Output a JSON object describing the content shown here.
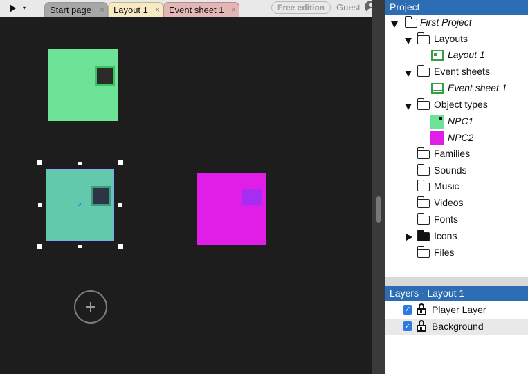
{
  "toolbar": {
    "tabs": [
      {
        "label": "Start page",
        "close": "×"
      },
      {
        "label": "Layout 1",
        "close": "×"
      },
      {
        "label": "Event sheet 1",
        "close": "×"
      }
    ],
    "edition_label": "Free edition",
    "user_label": "Guest",
    "play_dropdown": "▾"
  },
  "canvas": {
    "objects": [
      "NPC1",
      "NPC1",
      "NPC2"
    ],
    "selected_object": "NPC1",
    "add_button": "+"
  },
  "project": {
    "header": "Project",
    "root": "First Project",
    "items": [
      {
        "label": "Layouts",
        "expanded": true
      },
      {
        "label": "Layout 1"
      },
      {
        "label": "Event sheets",
        "expanded": true
      },
      {
        "label": "Event sheet 1"
      },
      {
        "label": "Object types",
        "expanded": true
      },
      {
        "label": "NPC1",
        "selected": true
      },
      {
        "label": "NPC2"
      },
      {
        "label": "Families"
      },
      {
        "label": "Sounds"
      },
      {
        "label": "Music"
      },
      {
        "label": "Videos"
      },
      {
        "label": "Fonts"
      },
      {
        "label": "Icons",
        "expanded": false
      },
      {
        "label": "Files"
      }
    ]
  },
  "layers": {
    "header": "Layers - Layout 1",
    "items": [
      {
        "label": "Player Layer",
        "visible": true,
        "check": "✓"
      },
      {
        "label": "Background",
        "visible": true,
        "check": "✓"
      }
    ]
  },
  "colors": {
    "accent": "#2c6db3",
    "npc1": "#6ce396",
    "npc2": "#e11ee8",
    "canvas": "#1d1d1d"
  }
}
